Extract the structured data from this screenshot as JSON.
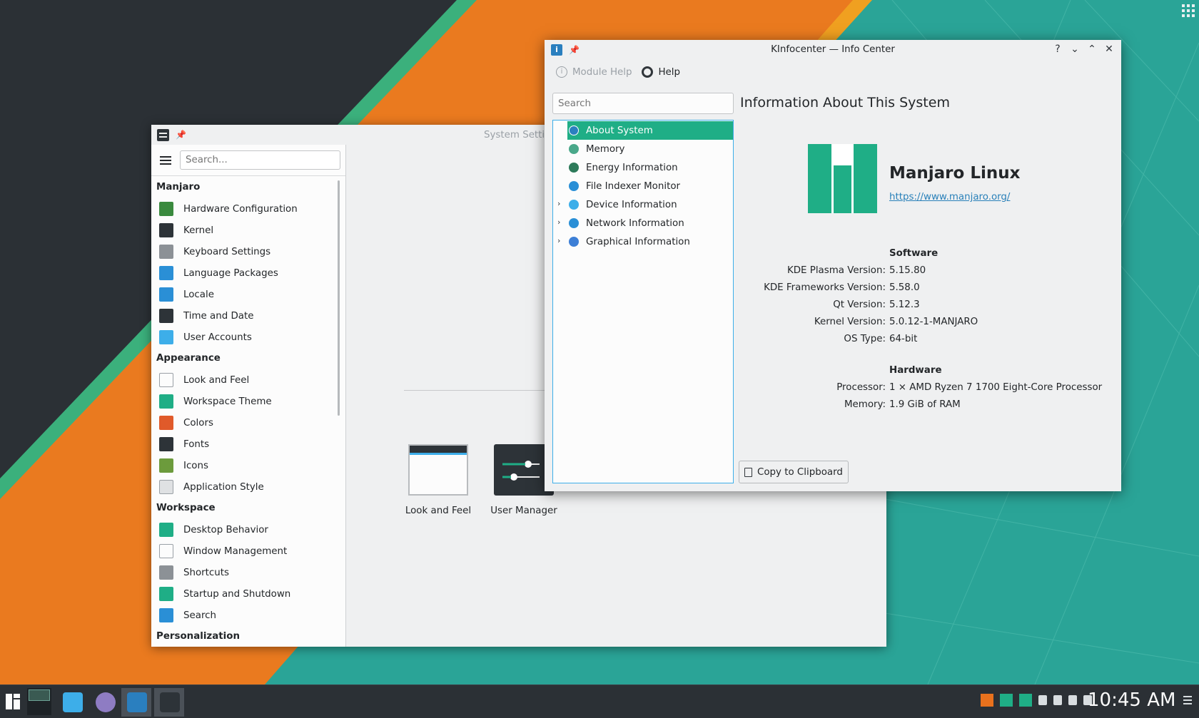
{
  "desktop": {
    "colors": {
      "teal": "#2ba89a",
      "orange": "#e8711d",
      "dark": "#2b3035",
      "green_stripe": "#3bb07c"
    }
  },
  "system_settings": {
    "title": "System Settings",
    "search_placeholder": "Search...",
    "categories": [
      {
        "header": "Manjaro",
        "items": [
          {
            "label": "Hardware Configuration",
            "icon": "hardware-icon",
            "color": "#3a8a3e"
          },
          {
            "label": "Kernel",
            "icon": "kernel-icon",
            "color": "#2d3338"
          },
          {
            "label": "Keyboard Settings",
            "icon": "keyboard-icon",
            "color": "#8c9196"
          },
          {
            "label": "Language Packages",
            "icon": "language-icon",
            "color": "#2a8fd6"
          },
          {
            "label": "Locale",
            "icon": "locale-icon",
            "color": "#2a8fd6"
          },
          {
            "label": "Time and Date",
            "icon": "clock-icon",
            "color": "#2d3338"
          },
          {
            "label": "User Accounts",
            "icon": "user-icon",
            "color": "#3daee9"
          }
        ]
      },
      {
        "header": "Appearance",
        "items": [
          {
            "label": "Look and Feel",
            "icon": "look-and-feel-icon",
            "color": "#fcfcfc"
          },
          {
            "label": "Workspace Theme",
            "icon": "workspace-theme-icon",
            "color": "#1fae86"
          },
          {
            "label": "Colors",
            "icon": "colors-icon",
            "color": "#e05a2a"
          },
          {
            "label": "Fonts",
            "icon": "fonts-icon",
            "color": "#2d3338"
          },
          {
            "label": "Icons",
            "icon": "icons-icon",
            "color": "#6c9b3c"
          },
          {
            "label": "Application Style",
            "icon": "app-style-icon",
            "color": "#dfe1e3"
          }
        ]
      },
      {
        "header": "Workspace",
        "items": [
          {
            "label": "Desktop Behavior",
            "icon": "desktop-behavior-icon",
            "color": "#1fae86"
          },
          {
            "label": "Window Management",
            "icon": "window-management-icon",
            "color": "#fcfcfc"
          },
          {
            "label": "Shortcuts",
            "icon": "shortcuts-icon",
            "color": "#8c9196"
          },
          {
            "label": "Startup and Shutdown",
            "icon": "startup-icon",
            "color": "#1fae86"
          },
          {
            "label": "Search",
            "icon": "search-icon",
            "color": "#2a8fd6"
          }
        ]
      },
      {
        "header": "Personalization",
        "items": []
      }
    ],
    "tiles": [
      {
        "label": "Look and Feel"
      },
      {
        "label": "User Manager"
      }
    ]
  },
  "info_center": {
    "title": "KInfocenter — Info Center",
    "toolbar": {
      "module_help": "Module Help",
      "help": "Help"
    },
    "search_placeholder": "Search",
    "tree": [
      {
        "label": "About System",
        "icon": "info-icon",
        "color": "#2a7fbf",
        "expandable": false,
        "selected": true
      },
      {
        "label": "Memory",
        "icon": "memory-icon",
        "color": "#4aa88a",
        "expandable": false,
        "selected": false
      },
      {
        "label": "Energy Information",
        "icon": "energy-icon",
        "color": "#2d7a5a",
        "expandable": false,
        "selected": false
      },
      {
        "label": "File Indexer Monitor",
        "icon": "file-indexer-icon",
        "color": "#2a8fd6",
        "expandable": false,
        "selected": false
      },
      {
        "label": "Device Information",
        "icon": "device-icon",
        "color": "#3daee9",
        "expandable": true,
        "selected": false
      },
      {
        "label": "Network Information",
        "icon": "network-icon",
        "color": "#2a8fd6",
        "expandable": true,
        "selected": false
      },
      {
        "label": "Graphical Information",
        "icon": "graphics-icon",
        "color": "#3d7fd6",
        "expandable": true,
        "selected": false
      }
    ],
    "heading": "Information About This System",
    "distro": {
      "name": "Manjaro Linux",
      "url": "https://www.manjaro.org/"
    },
    "software_header": "Software",
    "software": [
      {
        "key": "KDE Plasma Version:",
        "value": "5.15.80"
      },
      {
        "key": "KDE Frameworks Version:",
        "value": "5.58.0"
      },
      {
        "key": "Qt Version:",
        "value": "5.12.3"
      },
      {
        "key": "Kernel Version:",
        "value": "5.0.12-1-MANJARO"
      },
      {
        "key": "OS Type:",
        "value": "64-bit"
      }
    ],
    "hardware_header": "Hardware",
    "hardware": [
      {
        "key": "Processor:",
        "value": "1 × AMD Ryzen 7 1700 Eight-Core Processor"
      },
      {
        "key": "Memory:",
        "value": "1.9 GiB of RAM"
      }
    ],
    "copy_button": "Copy to Clipboard",
    "accent": "#1fae86"
  },
  "taskbar": {
    "clock": "10:45 AM",
    "tasks": [
      {
        "name": "dolphin-task",
        "color": "#3daee9",
        "active": false
      },
      {
        "name": "browser-task",
        "color": "#8e7cc3",
        "active": false
      },
      {
        "name": "kinfocenter-task",
        "color": "#2a7fbf",
        "active": true
      },
      {
        "name": "system-settings-task",
        "color": "#2d3338",
        "active": true
      }
    ],
    "tray_icons": [
      "manjaro-settings-icon",
      "software-update-icon",
      "manjaro-hello-icon",
      "usb-icon",
      "network-icon",
      "volume-icon",
      "tray-expand-icon"
    ]
  }
}
